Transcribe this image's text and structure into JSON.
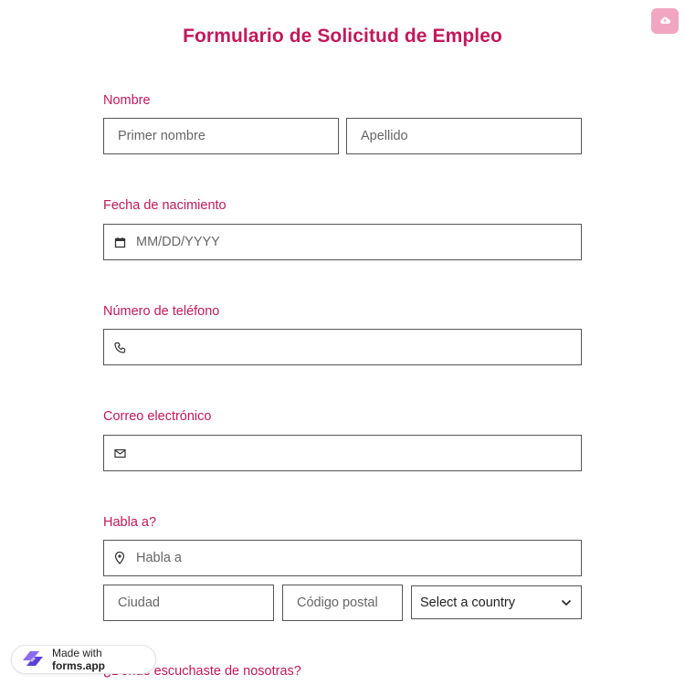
{
  "form": {
    "title": "Formulario de Solicitud de Empleo"
  },
  "name": {
    "label": "Nombre",
    "first_placeholder": "Primer nombre",
    "last_placeholder": "Apellido"
  },
  "dob": {
    "label": "Fecha de nacimiento",
    "placeholder": "MM/DD/YYYY",
    "icon": "calendar-icon"
  },
  "phone": {
    "label": "Número de teléfono",
    "placeholder": "",
    "icon": "phone-icon"
  },
  "email": {
    "label": "Correo electrónico",
    "placeholder": "",
    "icon": "mail-icon"
  },
  "address": {
    "label": "Habla a?",
    "street_placeholder": "Habla a",
    "city_placeholder": "Ciudad",
    "zip_placeholder": "Código postal",
    "country_value": "Select a country",
    "icon": "location-pin-icon"
  },
  "next_question": {
    "label": "¿Dónde escuchaste de nosotras?"
  },
  "badge": {
    "prefix": "Made with",
    "brand": "forms.app"
  },
  "colors": {
    "accent": "#c2185b",
    "corner_button": "#f2a5c0"
  }
}
